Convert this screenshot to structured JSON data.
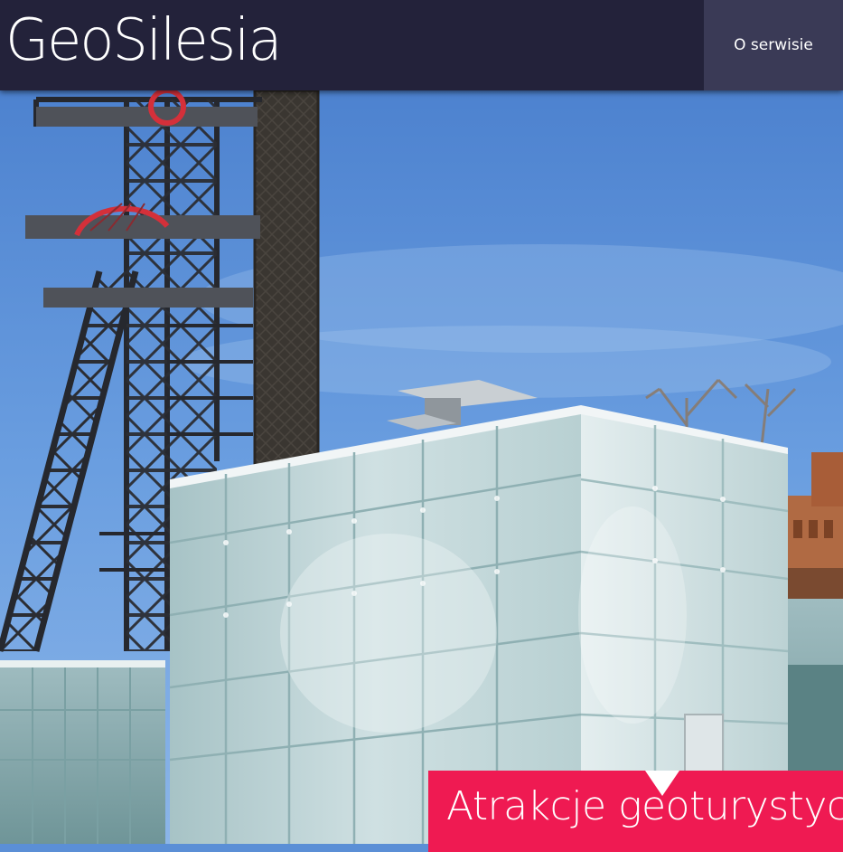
{
  "header": {
    "logo_text": "GeoSilesia",
    "nav": [
      {
        "label": "O serwisie"
      }
    ]
  },
  "banner": {
    "title": "Atrakcje geoturystyczne"
  },
  "colors": {
    "header_bg": "#23223a",
    "nav_bg": "#3a3a56",
    "banner_bg": "#ef1a52"
  },
  "hero": {
    "image_name": "mine-headframe-and-glass-museum-photo"
  }
}
